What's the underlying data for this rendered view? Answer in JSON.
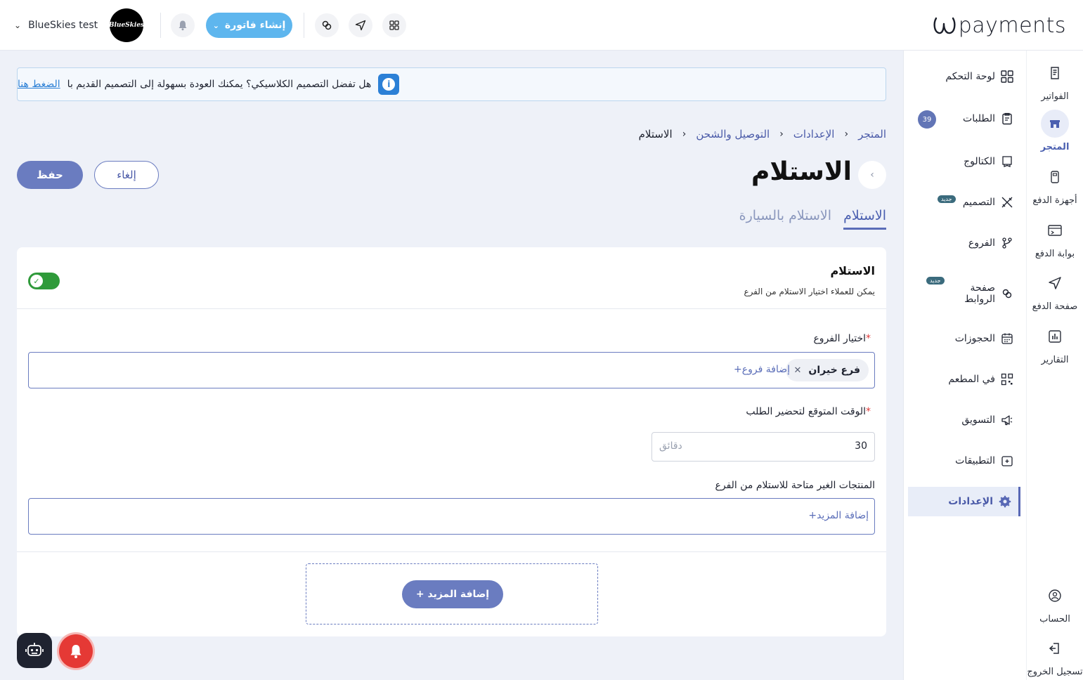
{
  "header": {
    "logo_text": "payments",
    "account_name": "BlueSkies testi…",
    "avatar_text": "BlueSkies",
    "create_invoice_label": "إنشاء فاتورة"
  },
  "rail": {
    "items": [
      {
        "label": "الفواتير",
        "icon": "invoice-icon"
      },
      {
        "label": "المتجر",
        "icon": "store-icon"
      },
      {
        "label": "أجهزة الدفع",
        "icon": "pos-device-icon"
      },
      {
        "label": "بوابة الدفع",
        "icon": "gateway-icon"
      },
      {
        "label": "صفحة الدفع",
        "icon": "send-icon"
      },
      {
        "label": "التقارير",
        "icon": "reports-icon"
      }
    ],
    "account_label": "الحساب",
    "logout_label": "تسجيل الخروج"
  },
  "submenu": {
    "items": [
      {
        "label": "لوحة التحكم"
      },
      {
        "label": "الطلبات",
        "count": "39"
      },
      {
        "label": "الكتالوج"
      },
      {
        "label": "التصميم",
        "badge": "جديد"
      },
      {
        "label": "الفروع"
      },
      {
        "label": "صفحة الروابط",
        "badge": "جديد"
      },
      {
        "label": "الحجوزات"
      },
      {
        "label": "في المطعم"
      },
      {
        "label": "التسويق"
      },
      {
        "label": "التطبيقات"
      },
      {
        "label": "الإعدادات"
      }
    ]
  },
  "banner": {
    "text": "هل تفضل التصميم الكلاسيكي؟ يمكنك العودة بسهولة إلى التصميم القديم با",
    "link": "الضغط هنا"
  },
  "breadcrumbs": [
    "المتجر",
    "الإعدادات",
    "التوصيل والشحن",
    "الاستلام"
  ],
  "page": {
    "title": "الاستلام",
    "save_label": "حفظ",
    "cancel_label": "إلغاء"
  },
  "tabs": [
    {
      "label": "الاستلام",
      "active": true
    },
    {
      "label": "الاستلام بالسيارة",
      "active": false
    }
  ],
  "card": {
    "title": "الاستلام",
    "subtitle": "يمكن للعملاء اختيار الاستلام من الفرع",
    "toggle_on": true,
    "branches_label": "اختيار الفروع",
    "required_mark": "*",
    "branch_chip": "فرع خيران",
    "add_branches_label": "+إضافة فروع",
    "prep_time_label": "الوقت المتوقع لتحضير الطلب",
    "prep_time_value": "30",
    "prep_time_unit": "دقائق",
    "unavailable_label": "المنتجات الغير متاحة للاستلام من الفرع",
    "add_more_inline": "+إضافة المزيد",
    "add_more_button": "+ إضافة المزيد"
  },
  "colors": {
    "primary": "#6a7cc0",
    "accent_blue": "#5eb6ee",
    "toggle_green": "#2f9a3a",
    "notif_red": "#e53935"
  }
}
